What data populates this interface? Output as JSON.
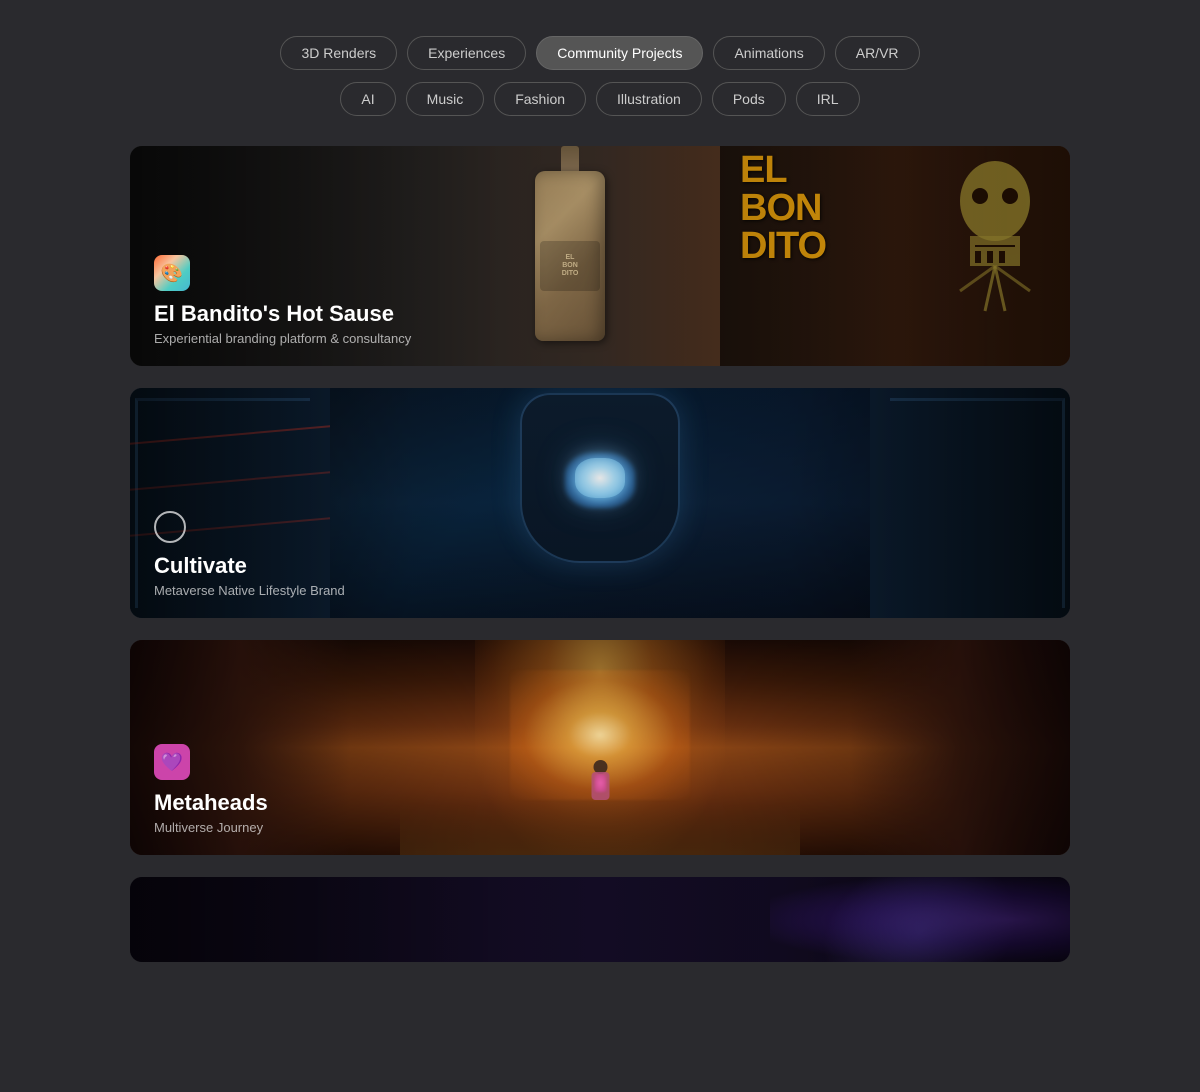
{
  "nav": {
    "row1": [
      {
        "id": "3d-renders",
        "label": "3D Renders",
        "active": false
      },
      {
        "id": "experiences",
        "label": "Experiences",
        "active": false
      },
      {
        "id": "community-projects",
        "label": "Community Projects",
        "active": true
      },
      {
        "id": "animations",
        "label": "Animations",
        "active": false
      },
      {
        "id": "ar-vr",
        "label": "AR/VR",
        "active": false
      }
    ],
    "row2": [
      {
        "id": "ai",
        "label": "AI",
        "active": false
      },
      {
        "id": "music",
        "label": "Music",
        "active": false
      },
      {
        "id": "fashion",
        "label": "Fashion",
        "active": false
      },
      {
        "id": "illustration",
        "label": "Illustration",
        "active": false
      },
      {
        "id": "pods",
        "label": "Pods",
        "active": false
      },
      {
        "id": "irl",
        "label": "IRL",
        "active": false
      }
    ]
  },
  "projects": [
    {
      "id": "el-bandito",
      "title": "El Bandito's Hot Sause",
      "subtitle": "Experiential branding platform & consultancy",
      "icon": "🎨"
    },
    {
      "id": "cultivate",
      "title": "Cultivate",
      "subtitle": "Metaverse Native Lifestyle Brand",
      "icon": "⬜"
    },
    {
      "id": "metaheads",
      "title": "Metaheads",
      "subtitle": "Multiverse Journey",
      "icon": "💜"
    },
    {
      "id": "card-4",
      "title": "",
      "subtitle": "",
      "icon": ""
    }
  ]
}
